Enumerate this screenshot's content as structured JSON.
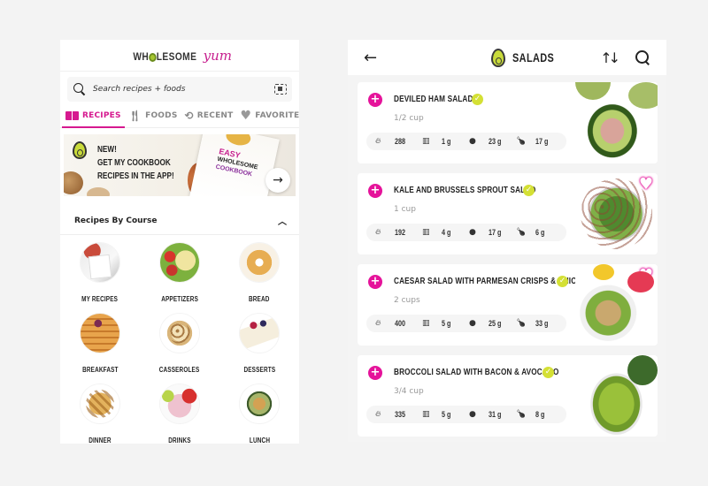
{
  "left": {
    "logo": {
      "main_prefix": "WH",
      "main_suffix": "LESOME",
      "script": "yum"
    },
    "search": {
      "placeholder": "Search recipes + foods"
    },
    "tabs": [
      {
        "label": "RECIPES",
        "icon": "book-icon",
        "active": true
      },
      {
        "label": "FOODS",
        "icon": "fork-knife-icon",
        "active": false
      },
      {
        "label": "RECENT",
        "icon": "history-icon",
        "active": false
      },
      {
        "label": "FAVORITES",
        "icon": "heart-icon",
        "active": false
      }
    ],
    "banner": {
      "line1": "NEW!",
      "line2": "GET MY COOKBOOK",
      "line3": "RECIPES IN THE APP!",
      "book_title1": "EASY",
      "book_title2": "WHOLESOME",
      "book_title3": "COOKBOOK"
    },
    "section": {
      "title": "Recipes By Course"
    },
    "courses": [
      {
        "label": "MY RECIPES"
      },
      {
        "label": "APPETIZERS"
      },
      {
        "label": "BREAD"
      },
      {
        "label": "BREAKFAST"
      },
      {
        "label": "CASSEROLES"
      },
      {
        "label": "DESSERTS"
      },
      {
        "label": "DINNER"
      },
      {
        "label": "DRINKS"
      },
      {
        "label": "LUNCH"
      }
    ]
  },
  "right": {
    "header": {
      "title": "SALADS"
    },
    "recipes": [
      {
        "name": "DEVILED HAM SALAD",
        "serving": "1/2 cup",
        "verified": true,
        "favorite": true,
        "calories": "288",
        "carbs": "1 g",
        "fat": "23 g",
        "protein": "17 g"
      },
      {
        "name": "KALE AND BRUSSELS SPROUT SALAD",
        "serving": "1 cup",
        "verified": true,
        "favorite": true,
        "calories": "192",
        "carbs": "4 g",
        "fat": "17 g",
        "protein": "6 g"
      },
      {
        "name": "CAESAR SALAD WITH PARMESAN CRISPS & CHIC...",
        "serving": "2 cups",
        "verified": true,
        "favorite": true,
        "calories": "400",
        "carbs": "5 g",
        "fat": "25 g",
        "protein": "33 g"
      },
      {
        "name": "BROCCOLI SALAD WITH BACON & AVOCADO",
        "serving": "3/4 cup",
        "verified": true,
        "favorite": true,
        "calories": "335",
        "carbs": "5 g",
        "fat": "31 g",
        "protein": "8 g"
      }
    ]
  },
  "colors": {
    "brand_pink": "#e5139a",
    "verified_lime": "#d4e035",
    "page_background": "#f3f3f3"
  }
}
